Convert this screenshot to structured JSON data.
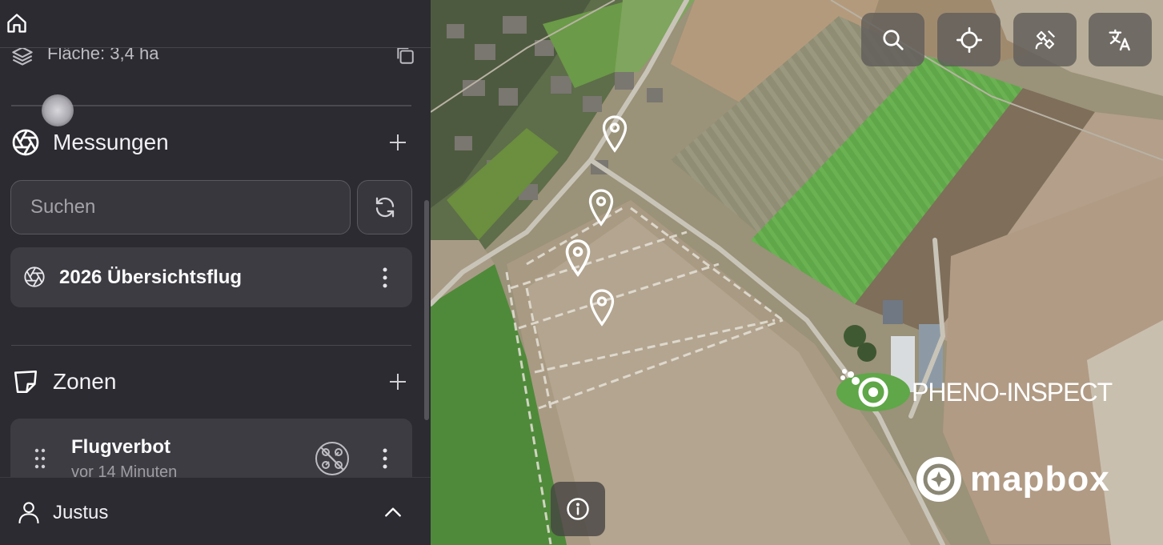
{
  "sidebar": {
    "area_label": "Fläche: 3,4 ha",
    "measurements": {
      "title": "Messungen",
      "search_placeholder": "Suchen",
      "items": [
        {
          "title": "2026 Übersichtsflug"
        }
      ]
    },
    "zones": {
      "title": "Zonen",
      "items": [
        {
          "title": "Flugverbot",
          "subtitle": "vor 14 Minuten"
        }
      ]
    },
    "user": {
      "name": "Justus"
    }
  },
  "map": {
    "controls": [
      "search-icon",
      "crosshair-icon",
      "satellite-icon",
      "translate-icon"
    ],
    "brand_logo": "PHENO-INSPECT",
    "attribution_logo": "mapbox"
  },
  "colors": {
    "sidebar_bg": "#2c2b31",
    "card_bg": "#3d3c43",
    "field_green": "#5fa748"
  }
}
